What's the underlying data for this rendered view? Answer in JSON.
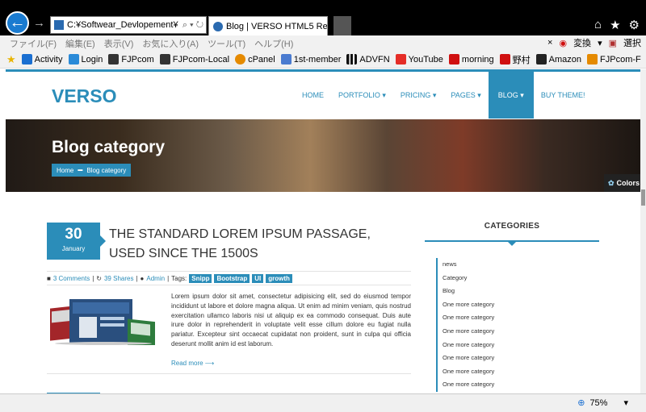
{
  "browser": {
    "address": "C:¥Softwear_Devlopement¥",
    "address_tools": "⌕ ▾ ↻",
    "tab_title": "Blog | VERSO HTML5 Re...",
    "tab_close": "×",
    "menu": [
      "ファイル(F)",
      "編集(E)",
      "表示(V)",
      "お気に入り(A)",
      "ツール(T)",
      "ヘルプ(H)"
    ],
    "menu_right": {
      "close": "×",
      "convert": "変換",
      "dropdown": "▾",
      "select": "選択"
    },
    "favorites": [
      {
        "label": "Activity",
        "color": "#1a6fd1"
      },
      {
        "label": "Login",
        "color": "#2a8ad8"
      },
      {
        "label": "FJPcom",
        "color": "#333333"
      },
      {
        "label": "FJPcom-Local",
        "color": "#333333"
      },
      {
        "label": "cPanel",
        "color": "#e58a00"
      },
      {
        "label": "1st-member",
        "color": "#4a7bd0"
      },
      {
        "label": "ADVFN",
        "color": "#111111"
      },
      {
        "label": "YouTube",
        "color": "#e52d27"
      },
      {
        "label": "morning",
        "color": "#d01010"
      },
      {
        "label": "野村",
        "color": "#d01010"
      },
      {
        "label": "Amazon",
        "color": "#222222"
      },
      {
        "label": "FJPcom-F",
        "color": "#e58a00"
      }
    ],
    "favbar_chevron": "»",
    "zoom": "75%",
    "zoom_dropdown": "▾"
  },
  "site": {
    "logo": "VERSO",
    "nav": [
      "HOME",
      "PORTFOLIO ▾",
      "PRICING ▾",
      "PAGES ▾",
      "BLOG ▾",
      "BUY THEME!"
    ],
    "nav_active_index": 4,
    "hero_title": "Blog category",
    "breadcrumb": {
      "home": "Home",
      "sep": "▬",
      "current": "Blog category"
    },
    "colors_button": "Colors",
    "post": {
      "day": "30",
      "month": "January",
      "title": "THE STANDARD LOREM IPSUM PASSAGE, USED SINCE THE 1500S",
      "comments": "3 Comments",
      "shares": "39 Shares",
      "author": "Admin",
      "tags_label": "Tags:",
      "tags": [
        "Snipp",
        "Bootstrap",
        "UI",
        "growth"
      ],
      "excerpt": "Lorem ipsum dolor sit amet, consectetur adipisicing elit, sed do eiusmod tempor incididunt ut labore et dolore magna aliqua. Ut enim ad minim veniam, quis nostrud exercitation ullamco laboris nisi ut aliquip ex ea commodo consequat. Duis aute irure dolor in reprehenderit in voluptate velit esse cillum dolore eu fugiat nulla pariatur. Excepteur sint occaecat cupidatat non proident, sunt in culpa qui officia deserunt mollit anim id est laborum.",
      "read_more": "Read more ⟶"
    },
    "categories_title": "CATEGORIES",
    "categories": [
      "news",
      "Category",
      "Blog",
      "One more category",
      "One more category",
      "One more category",
      "One more category",
      "One more category",
      "One more category",
      "One more category"
    ]
  },
  "colors": {
    "accent": "#2b8db9"
  }
}
